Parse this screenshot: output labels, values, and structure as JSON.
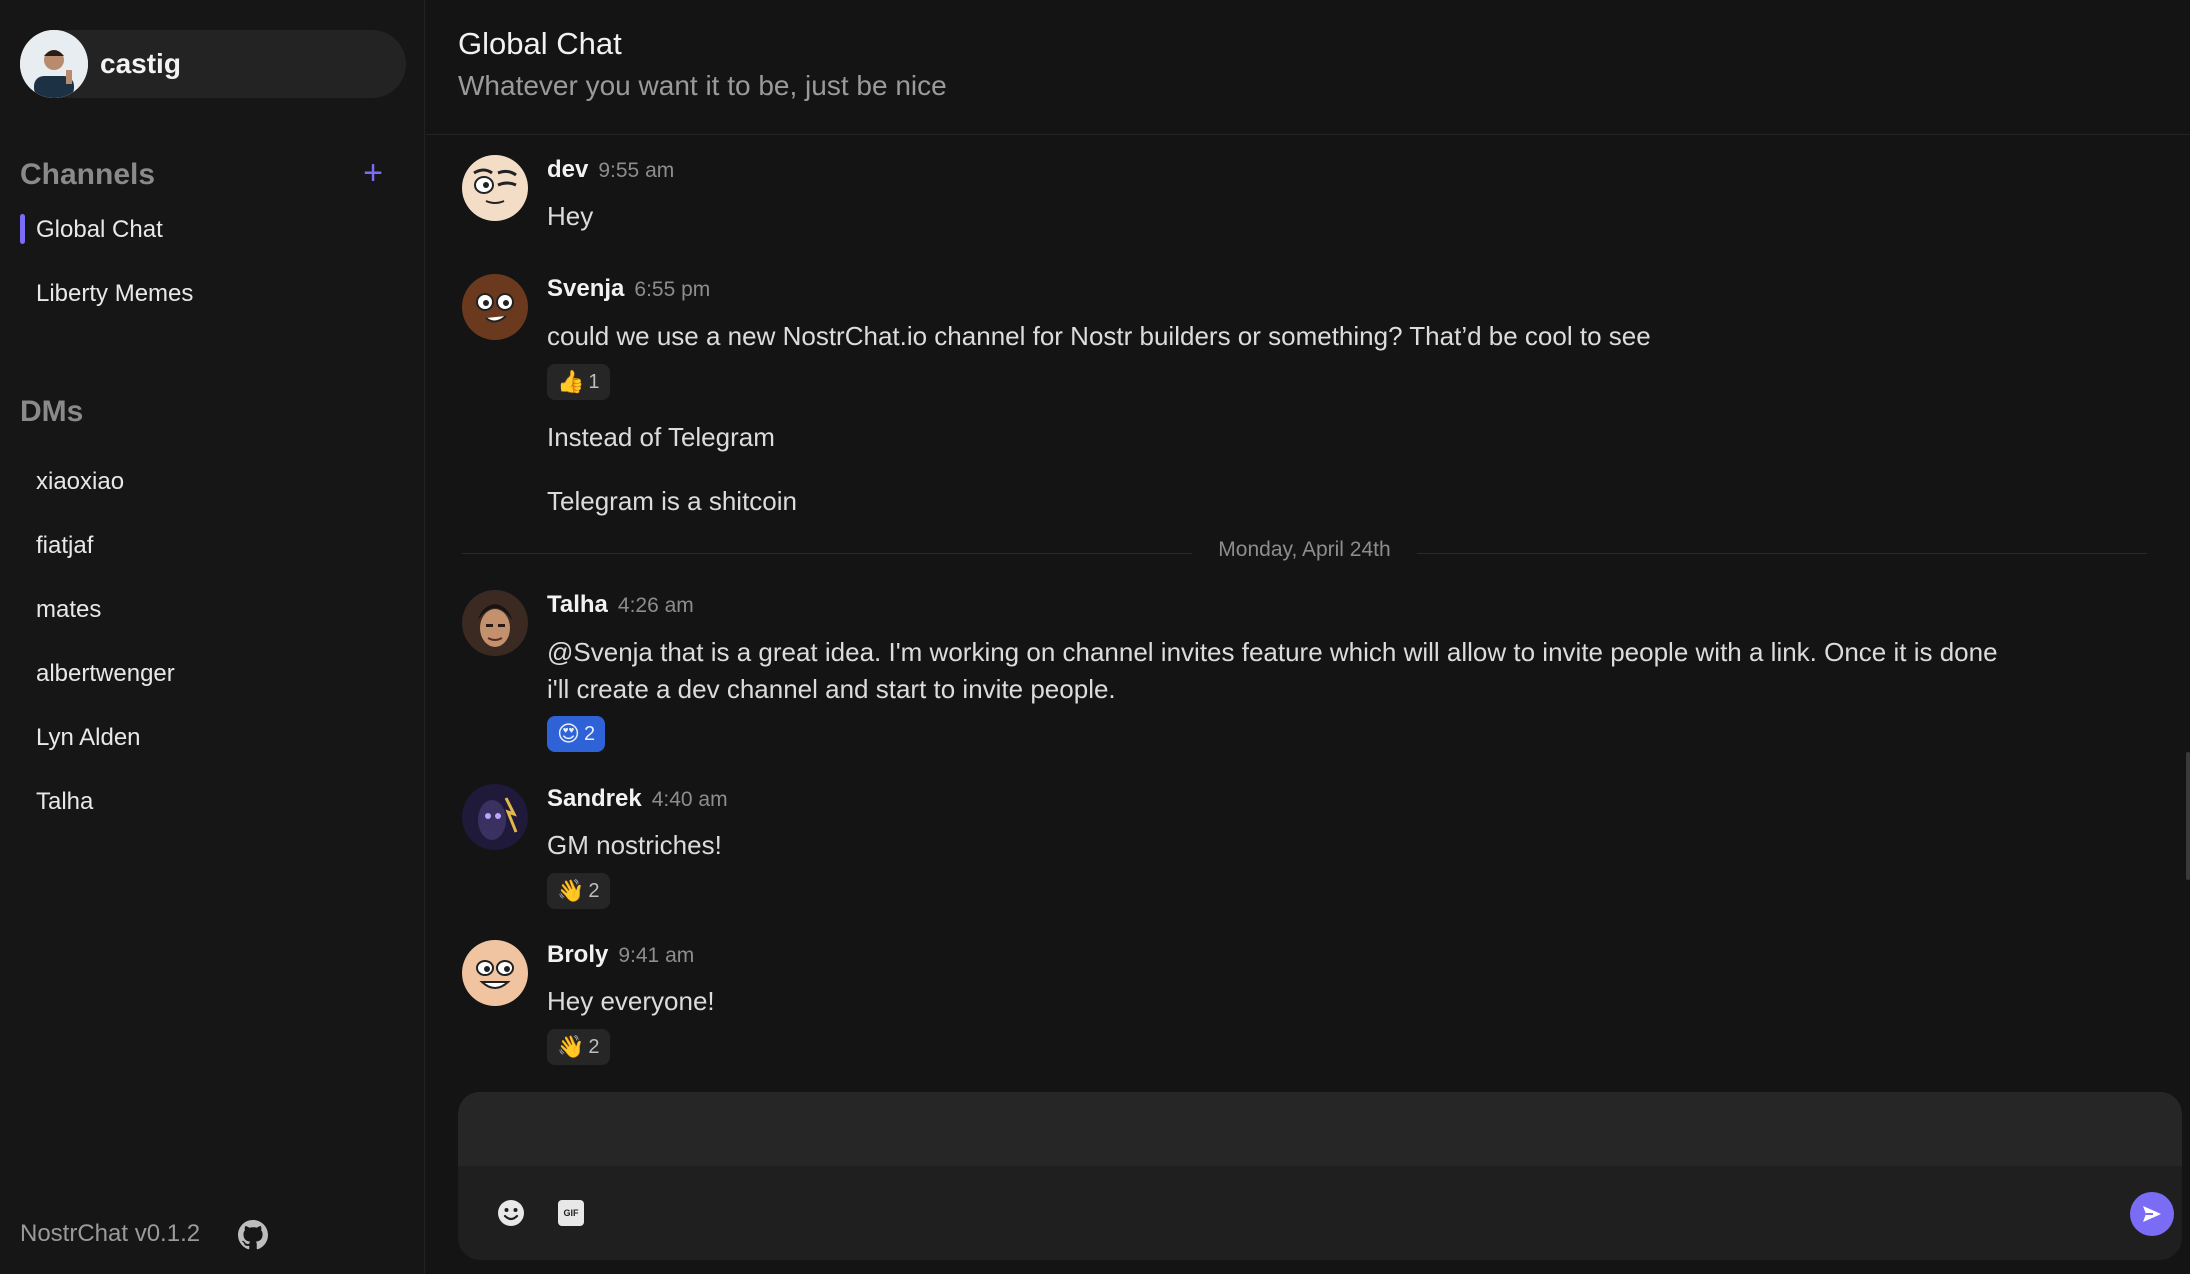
{
  "profile": {
    "name": "castig"
  },
  "sidebar": {
    "channels_title": "Channels",
    "channels": [
      {
        "label": "Global Chat",
        "active": true
      },
      {
        "label": "Liberty Memes",
        "active": false
      }
    ],
    "dms_title": "DMs",
    "dms": [
      {
        "label": "xiaoxiao"
      },
      {
        "label": "fiatjaf"
      },
      {
        "label": "mates"
      },
      {
        "label": "albertwenger"
      },
      {
        "label": "Lyn Alden"
      },
      {
        "label": "Talha"
      }
    ],
    "version": "NostrChat v0.1.2"
  },
  "header": {
    "title": "Global Chat",
    "subtitle": "Whatever you want it to be, just be nice"
  },
  "messages": [
    {
      "author": "dev",
      "time": "9:55 am",
      "lines": [
        "Hey"
      ]
    },
    {
      "author": "Svenja",
      "time": "6:55 pm",
      "lines": [
        "could we use a new NostrChat.io channel for Nostr builders or something? That’d be cool to see",
        "Instead of Telegram",
        "Telegram is a shitcoin"
      ],
      "reaction": {
        "emoji": "👍",
        "count": "1"
      }
    },
    {
      "author": "Talha",
      "time": "4:26 am",
      "lines": [
        "@Svenja that is a great idea. I'm working on channel invites feature which will allow to invite people with a link. Once it is done",
        "i'll create a dev channel and start to invite people."
      ],
      "reaction": {
        "emoji": "😍",
        "count": "2"
      }
    },
    {
      "author": "Sandrek",
      "time": "4:40 am",
      "lines": [
        "GM nostriches!"
      ],
      "reaction": {
        "emoji": "👋",
        "count": "2"
      }
    },
    {
      "author": "Broly",
      "time": "9:41 am",
      "lines": [
        "Hey everyone!"
      ],
      "reaction": {
        "emoji": "👋",
        "count": "2"
      }
    }
  ],
  "date_divider": "Monday, April 24th",
  "composer": {
    "value": "",
    "placeholder": "",
    "gif_label": "GIF"
  },
  "icons": {
    "add": "plus-icon",
    "github": "github-icon",
    "emoji": "smiley-icon",
    "gif": "gif-icon",
    "send": "send-icon"
  },
  "colors": {
    "accent": "#7b6cf6",
    "active_reaction": "#2f62d6"
  }
}
